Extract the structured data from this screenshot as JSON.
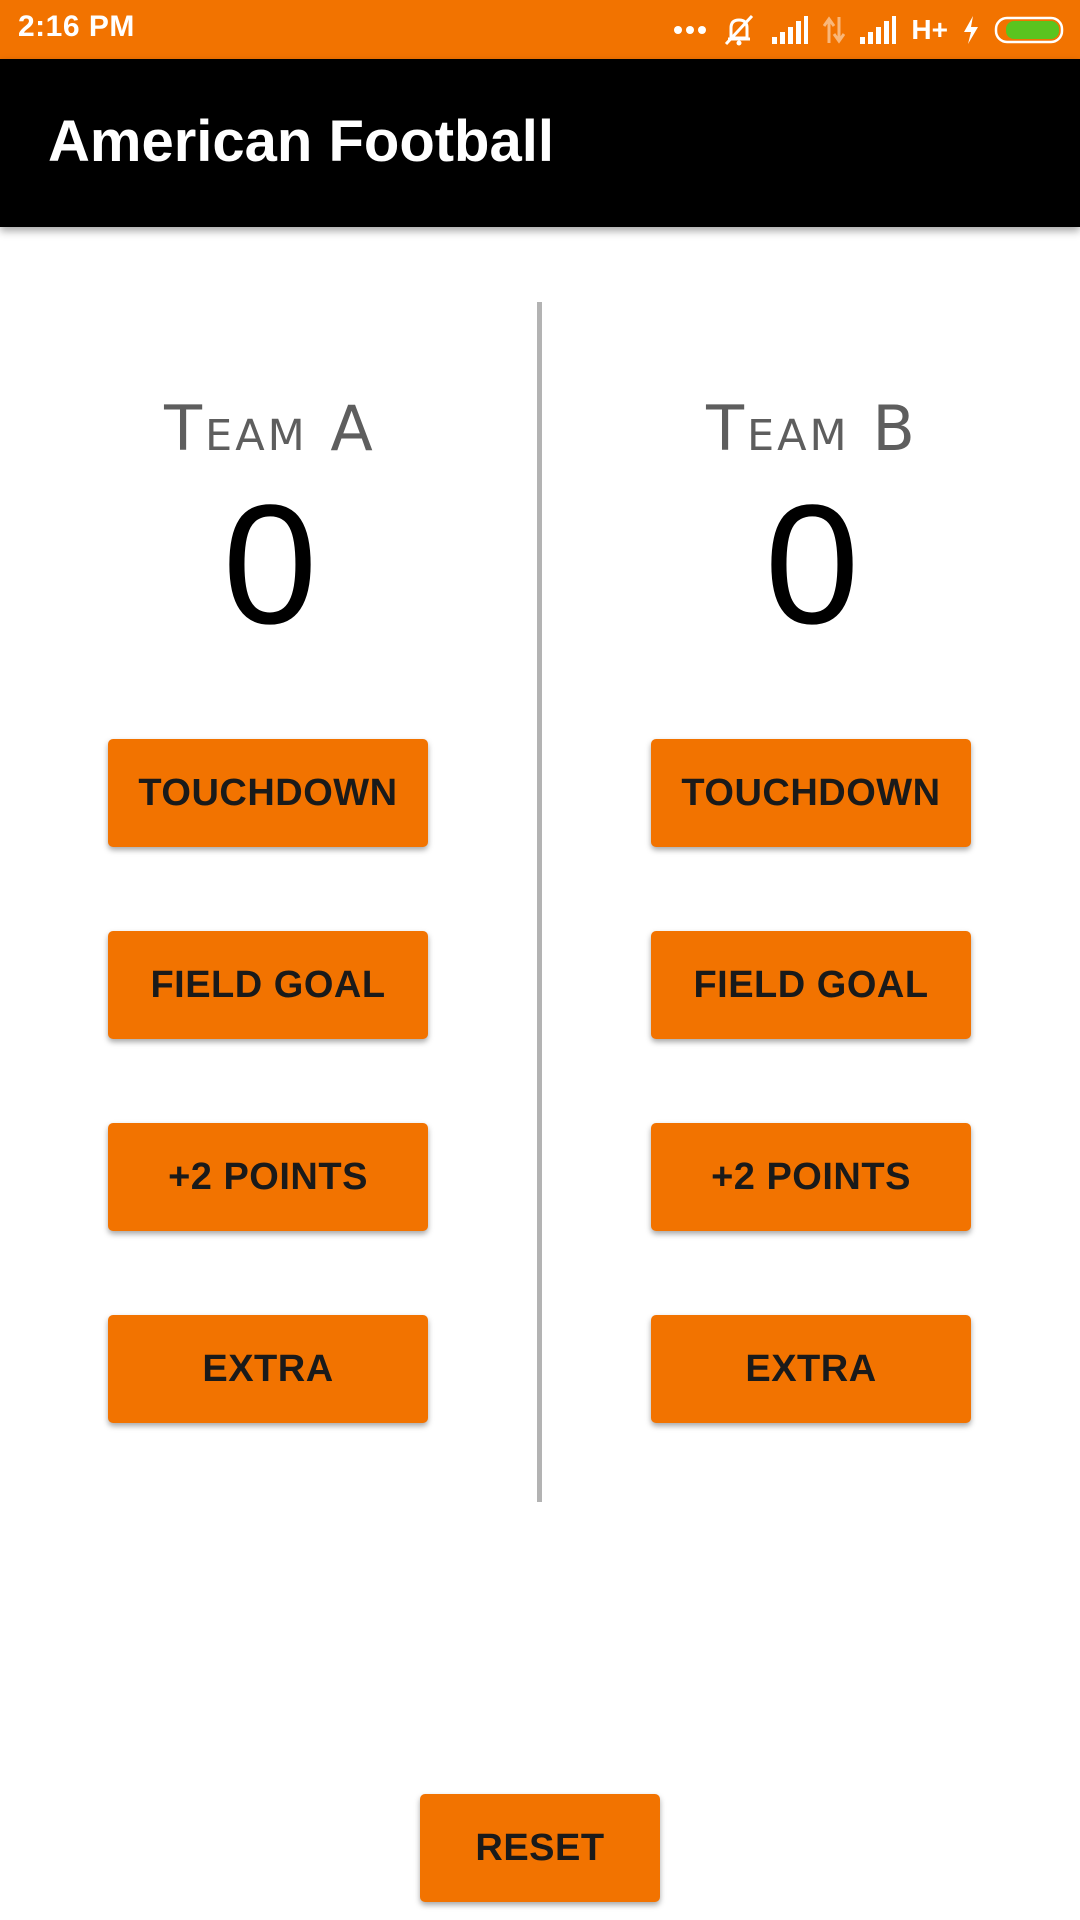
{
  "status_bar": {
    "time": "2:16 PM",
    "network_label": "H+",
    "icons": [
      "more-dots-icon",
      "mute-bell-icon",
      "signal-icon",
      "data-arrows-icon",
      "signal-icon",
      "charging-bolt-icon",
      "battery-icon"
    ],
    "color": "#F27300"
  },
  "app_bar": {
    "title": "American Football",
    "background": "#000000"
  },
  "team_a": {
    "name": "Team A",
    "score": "0",
    "buttons": {
      "touchdown": "TOUCHDOWN",
      "field_goal": "FIELD GOAL",
      "two_points": "+2 POINTS",
      "extra": "EXTRA"
    }
  },
  "team_b": {
    "name": "Team B",
    "score": "0",
    "buttons": {
      "touchdown": "TOUCHDOWN",
      "field_goal": "FIELD GOAL",
      "two_points": "+2 POINTS",
      "extra": "EXTRA"
    }
  },
  "reset_label": "RESET",
  "colors": {
    "accent": "#F27300",
    "divider": "#B3B3B3",
    "team_name": "#5E5E5E"
  }
}
